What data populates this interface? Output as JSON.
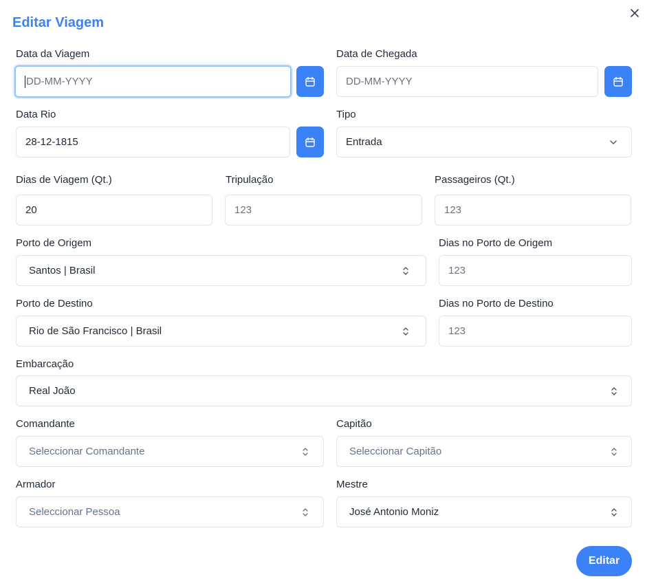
{
  "dialog": {
    "title": "Editar Viagem"
  },
  "fields": {
    "data_viagem": {
      "label": "Data da Viagem",
      "placeholder": "DD-MM-YYYY",
      "value": ""
    },
    "data_chegada": {
      "label": "Data de Chegada",
      "placeholder": "DD-MM-YYYY",
      "value": ""
    },
    "data_rio": {
      "label": "Data Rio",
      "value": "28-12-1815"
    },
    "tipo": {
      "label": "Tipo",
      "value": "Entrada"
    },
    "dias_viagem": {
      "label": "Dias de Viagem (Qt.)",
      "value": "20"
    },
    "tripulacao": {
      "label": "Tripulação",
      "placeholder": "123"
    },
    "passageiros": {
      "label": "Passageiros (Qt.)",
      "placeholder": "123"
    },
    "porto_origem": {
      "label": "Porto de Origem",
      "value": "Santos | Brasil"
    },
    "dias_porto_origem": {
      "label": "Dias no Porto de Origem",
      "placeholder": "123"
    },
    "porto_destino": {
      "label": "Porto de Destino",
      "value": "Rio de São Francisco | Brasil"
    },
    "dias_porto_destino": {
      "label": "Dias no Porto de Destino",
      "placeholder": "123"
    },
    "embarcacao": {
      "label": "Embarcação",
      "value": "Real João"
    },
    "comandante": {
      "label": "Comandante",
      "placeholder": "Seleccionar Comandante"
    },
    "capitao": {
      "label": "Capitão",
      "placeholder": "Seleccionar Capitão"
    },
    "armador": {
      "label": "Armador",
      "placeholder": "Seleccionar Pessoa"
    },
    "mestre": {
      "label": "Mestre",
      "value": "José Antonio Moniz"
    }
  },
  "actions": {
    "submit_label": "Editar"
  },
  "icons": {
    "close": "close-icon",
    "calendar": "calendar-icon",
    "chevron": "chevron-down-icon",
    "updown": "chevron-up-down-icon"
  },
  "colors": {
    "accent": "#3b82f6",
    "focus_ring": "#93c5fd",
    "border": "#e2e4e9",
    "placeholder": "#6b7280"
  }
}
